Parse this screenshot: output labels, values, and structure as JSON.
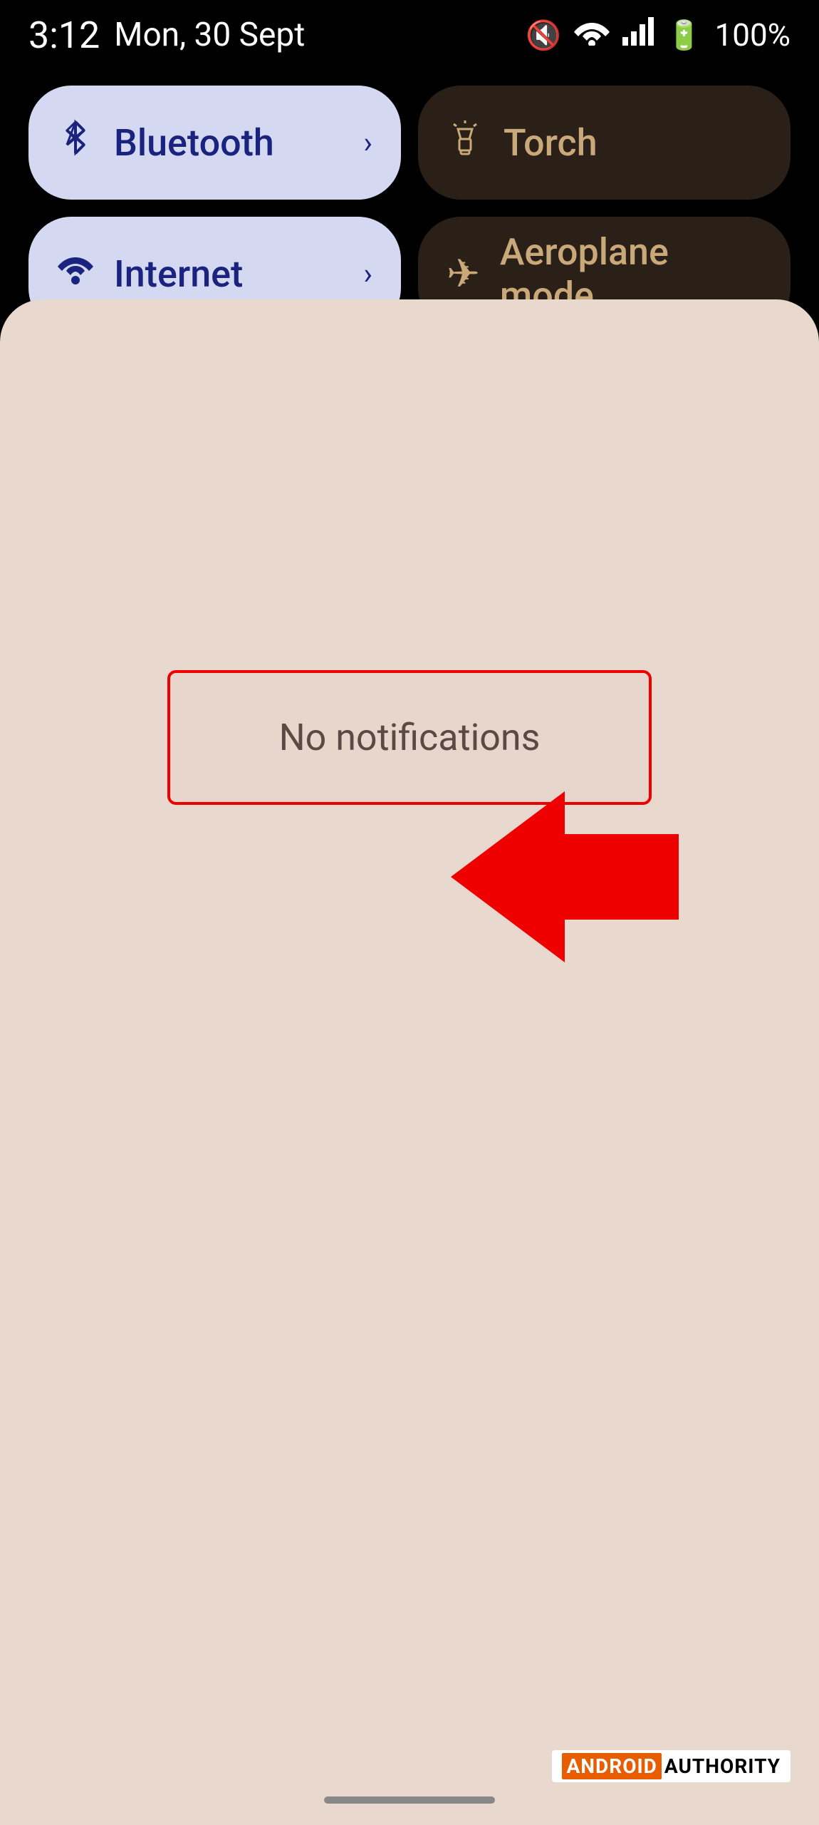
{
  "statusBar": {
    "time": "3:12",
    "date": "Mon, 30 Sept",
    "battery": "100%"
  },
  "quickSettings": {
    "tiles": [
      {
        "id": "bluetooth",
        "label": "Bluetooth",
        "icon": "bluetooth",
        "active": true,
        "hasChevron": true
      },
      {
        "id": "torch",
        "label": "Torch",
        "icon": "torch",
        "active": false,
        "hasChevron": false
      },
      {
        "id": "internet",
        "label": "Internet",
        "icon": "wifi",
        "active": true,
        "hasChevron": true
      },
      {
        "id": "aeroplane",
        "label": "Aeroplane mode",
        "icon": "plane",
        "active": false,
        "hasChevron": false
      }
    ]
  },
  "notifications": {
    "emptyText": "No notifications"
  },
  "watermark": {
    "brand": "ANDROID",
    "suffix": "AUTHORITY"
  }
}
